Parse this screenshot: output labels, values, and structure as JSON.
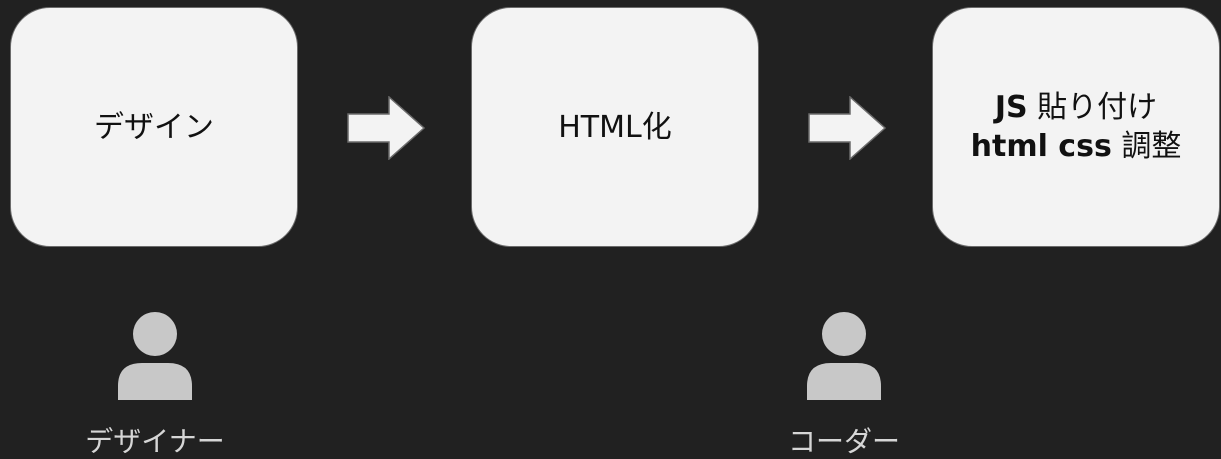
{
  "steps": [
    {
      "label": "デザイン"
    },
    {
      "label": "HTML化"
    },
    {
      "line1_bold": "JS",
      "line1_rest": " 貼り付け",
      "line2_bold": "html css",
      "line2_rest": " 調整"
    }
  ],
  "roles": [
    {
      "label": "デザイナー",
      "icon": "person-icon"
    },
    {
      "label": "コーダー",
      "icon": "person-icon"
    }
  ],
  "colors": {
    "background": "#212121",
    "box_fill": "#f3f3f3",
    "arrow_fill": "#f3f3f3",
    "icon_fill": "#c8c8c8"
  }
}
